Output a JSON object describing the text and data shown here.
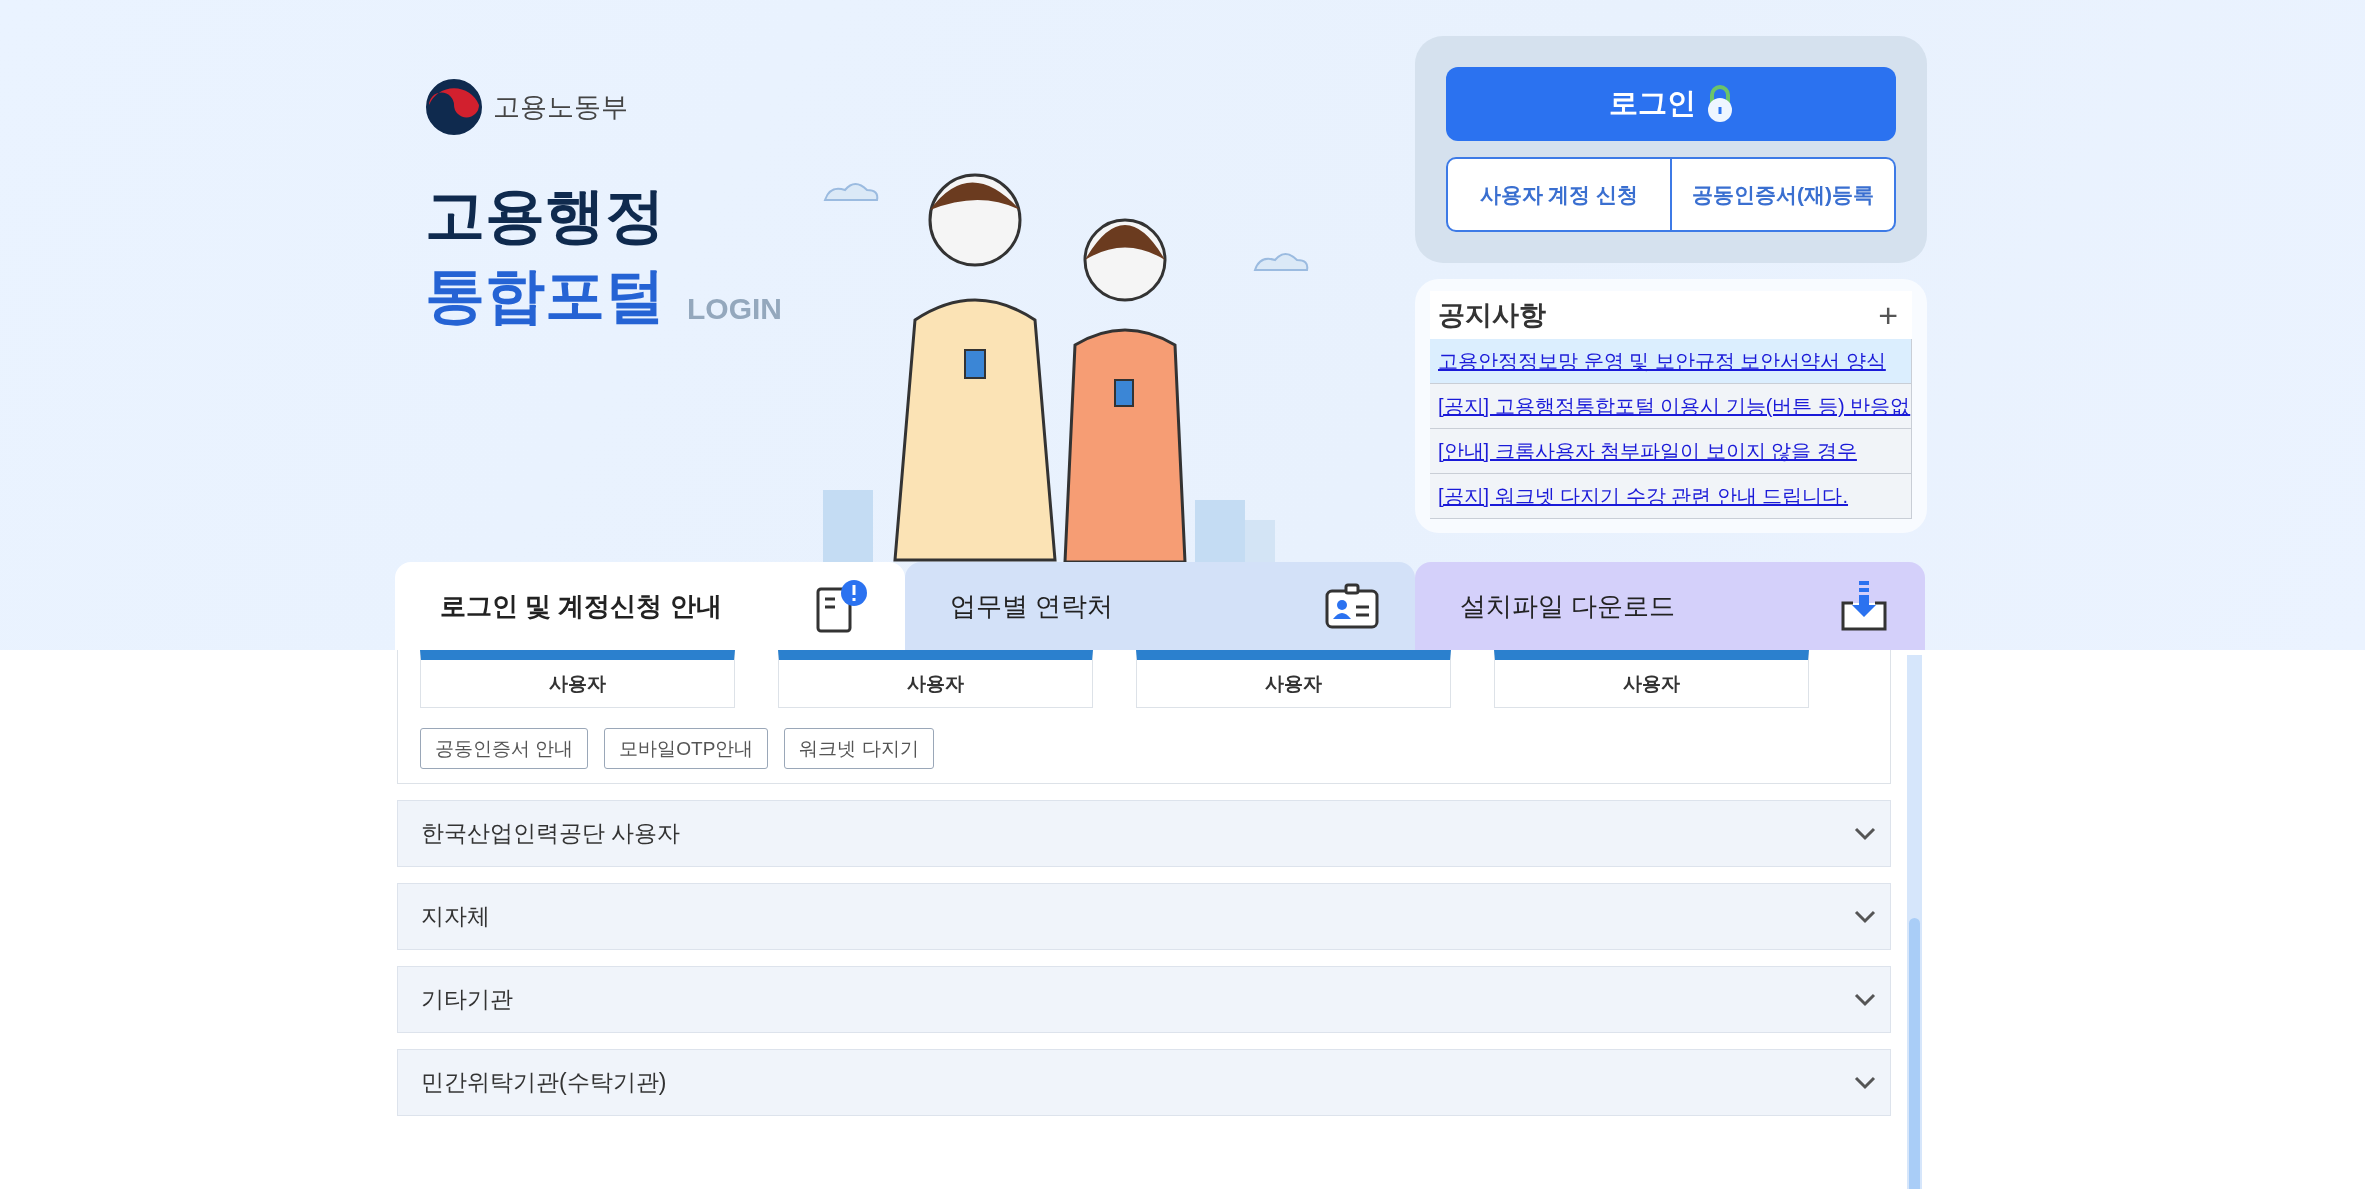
{
  "brand": {
    "ministry": "고용노동부",
    "title_line1": "고용행정",
    "title_line2": "통합포털",
    "title_suffix": "LOGIN"
  },
  "login": {
    "login_button": "로그인",
    "buttons": [
      "사용자 계정 신청",
      "공동인증서(재)등록"
    ]
  },
  "notices": {
    "title": "공지사항",
    "more": "+",
    "items": [
      {
        "text": "고용안정정보망 운영 및 보안규정 보안서약서 양식",
        "selected": true
      },
      {
        "text": "[공지] 고용행정통합포털 이용시 기능(버튼 등) 반응없",
        "selected": false
      },
      {
        "text": "[안내] 크롬사용자 첨부파일이 보이지 않을 경우",
        "selected": false
      },
      {
        "text": "[공지] 워크넷 다지기 수강 관련 안내 드립니다.",
        "selected": false
      }
    ]
  },
  "tabs": [
    {
      "label": "로그인 및 계정신청 안내",
      "kind": "guide",
      "selected": true
    },
    {
      "label": "업무별 연락처",
      "kind": "contact",
      "selected": false
    },
    {
      "label": "설치파일 다운로드",
      "kind": "download",
      "selected": false
    }
  ],
  "user_cards": [
    "사용자",
    "사용자",
    "사용자",
    "사용자"
  ],
  "guide_buttons": [
    "공동인증서 안내",
    "모바일OTP안내",
    "워크넷 다지기"
  ],
  "accordion": [
    {
      "label": "한국산업인력공단 사용자",
      "expanded": false
    },
    {
      "label": "지자체",
      "expanded": false
    },
    {
      "label": "기타기관",
      "expanded": false
    },
    {
      "label": "민간위탁기관(수탁기관)",
      "expanded": false
    }
  ]
}
